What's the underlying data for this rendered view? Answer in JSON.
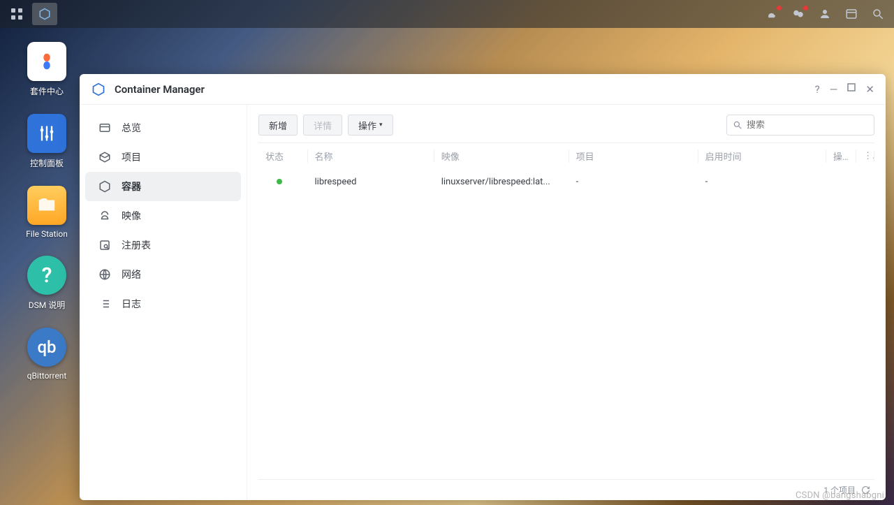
{
  "taskbar": {},
  "desktop": [
    {
      "label": "套件中心",
      "bg": "#fff"
    },
    {
      "label": "控制面板",
      "bg": "#2f72d9"
    },
    {
      "label": "File Station",
      "bg": "#ffb640"
    },
    {
      "label": "DSM 说明",
      "bg": "#2dbfa8"
    },
    {
      "label": "qBittorrent",
      "bg": "#3b7ac6"
    }
  ],
  "window": {
    "title": "Container Manager",
    "sidebar": [
      {
        "label": "总览"
      },
      {
        "label": "项目"
      },
      {
        "label": "容器",
        "selected": true
      },
      {
        "label": "映像"
      },
      {
        "label": "注册表"
      },
      {
        "label": "网络"
      },
      {
        "label": "日志"
      }
    ],
    "toolbar": {
      "add": "新增",
      "detail": "详情",
      "action": "操作"
    },
    "search": {
      "placeholder": "搜索"
    },
    "columns": {
      "status": "状态",
      "name": "名称",
      "image": "映像",
      "project": "项目",
      "uptime": "启用时间",
      "op": "操...",
      "more": "⋮"
    },
    "rows": [
      {
        "status": "running",
        "name": "librespeed",
        "image": "linuxserver/librespeed:lat...",
        "project": "-",
        "uptime": "-"
      }
    ],
    "footer": {
      "count": "1 个项目"
    }
  },
  "watermark": "CSDN @bangshabgni"
}
